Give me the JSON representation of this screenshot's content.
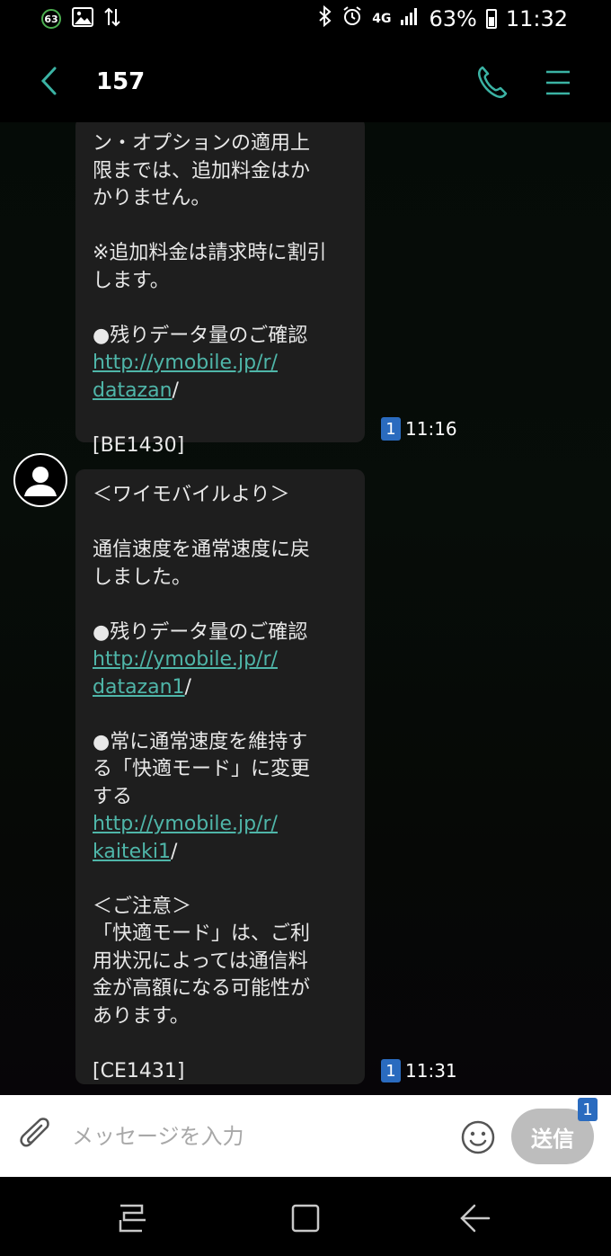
{
  "status_bar": {
    "notification_badge": "63",
    "network": "4G",
    "battery_percent": "63%",
    "time": "11:32",
    "icons": [
      "image-icon",
      "data-sync-icon",
      "bluetooth-icon",
      "alarm-icon",
      "signal-icon",
      "battery-icon"
    ]
  },
  "header": {
    "title": "157",
    "back_icon": "chevron-left-icon",
    "call_icon": "phone-icon",
    "menu_icon": "menu-icon"
  },
  "messages": [
    {
      "lines": [
        "ン・オプションの適用上",
        "限までは、追加料金はか",
        "かりません。",
        "",
        "※追加料金は請求時に割引",
        "します。",
        "",
        "●残りデータ量のご確認"
      ],
      "link_line1": "http://ymobile.jp/r/",
      "link_line2": "datazan",
      "link_suffix": "/",
      "code": "[BE1430]",
      "unread_count": "1",
      "time": "11:16"
    },
    {
      "lines_a": [
        "＜ワイモバイルより＞",
        "",
        "通信速度を通常速度に戻",
        "しました。",
        "",
        "●残りデータ量のご確認"
      ],
      "link1_line1": "http://ymobile.jp/r/",
      "link1_line2": "datazan1",
      "link1_suffix": "/",
      "lines_b": [
        "●常に通常速度を維持す",
        "る「快適モード」に変更",
        "する"
      ],
      "link2_line1": "http://ymobile.jp/r/",
      "link2_line2": "kaiteki1",
      "link2_suffix": "/",
      "lines_c": [
        "＜ご注意＞",
        "「快適モード」は、ご利",
        "用状況によっては通信料",
        "金が高額になる可能性が",
        "あります。"
      ],
      "code": "[CE1431]",
      "unread_count": "1",
      "time": "11:31"
    }
  ],
  "composer": {
    "placeholder": "メッセージを入力",
    "send_label": "送信",
    "send_badge": "1"
  },
  "navigation": {
    "items": [
      "recent-apps-icon",
      "home-icon",
      "back-icon"
    ]
  },
  "colors": {
    "link": "#4fb6a9",
    "accent": "#3bb3a4",
    "bubble": "#1e1e1e",
    "unread_badge": "#2a6bbf"
  }
}
